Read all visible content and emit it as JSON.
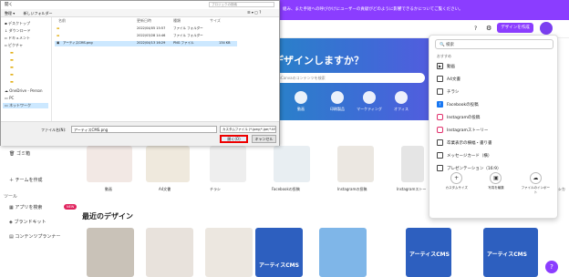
{
  "banner": {
    "text": "組み、また手短への呼びかけにユーザーの貢献がどのように影響できるかについてご覧ください。"
  },
  "topbar": {
    "create_button": "デザインを作成",
    "help_icon": "?",
    "settings_icon": "gear"
  },
  "hero": {
    "title": "デザインしますか？",
    "search_placeholder": "お使いのCanvaのコンテンツを検索"
  },
  "hero_categories": [
    {
      "label": "動画"
    },
    {
      "label": "印刷製品"
    },
    {
      "label": "マーケティング"
    },
    {
      "label": "オフィス"
    }
  ],
  "sidebar": {
    "items": [
      {
        "label": "ゴミ箱"
      },
      {
        "label": "チームを作成"
      },
      {
        "label": "ツール"
      },
      {
        "label": "アプリを検索"
      },
      {
        "label": "ブランドキット"
      },
      {
        "label": "コンテンツプランナー"
      }
    ],
    "new_badge": "NEW"
  },
  "templates": [
    {
      "label": "動画"
    },
    {
      "label": "A4文書"
    },
    {
      "label": "チラシ"
    },
    {
      "label": "Facebookの投稿"
    },
    {
      "label": "Instagramの投稿"
    },
    {
      "label": "Instagramストー"
    },
    {
      "label": "セーシカ"
    }
  ],
  "recent": {
    "title": "最近のデザイン",
    "tile_texts": [
      "アーティスCMS",
      "アーティスCMS",
      "アーティスCMS"
    ]
  },
  "dropdown": {
    "search_value": "検索",
    "section_label": "おすすめ",
    "items": [
      {
        "label": "動画",
        "icon": "video-icon"
      },
      {
        "label": "A4文書",
        "icon": "doc-icon"
      },
      {
        "label": "チラシ",
        "icon": "flyer-icon"
      },
      {
        "label": "Facebookの投稿",
        "icon": "facebook-icon"
      },
      {
        "label": "Instagramの投稿",
        "icon": "instagram-icon"
      },
      {
        "label": "Instagramストーリー",
        "icon": "instagram-icon"
      },
      {
        "label": "卒業表示の横幅・書り書",
        "icon": "doc-icon"
      },
      {
        "label": "メッセージカード（横）",
        "icon": "card-icon"
      },
      {
        "label": "プレゼンテーション（16:9）",
        "icon": "presentation-icon"
      }
    ],
    "bottom": [
      {
        "label": "カスタムサイズ",
        "icon": "+"
      },
      {
        "label": "写真を編集",
        "icon": "▣"
      },
      {
        "label": "ファイルのインポート",
        "icon": "☁"
      }
    ]
  },
  "file_dialog": {
    "title": "開く",
    "search_placeholder": "プロジェクの検索",
    "toolbar": {
      "organize": "整理 ▾",
      "new_folder": "新しいフォルダー"
    },
    "tree": [
      {
        "label": "デスクトップ"
      },
      {
        "label": "ダウンロード"
      },
      {
        "label": "ドキュメント"
      },
      {
        "label": "ピクチャ"
      },
      {
        "label": "OneDrive - Person"
      },
      {
        "label": "PC"
      },
      {
        "label": "ネットワーク"
      }
    ],
    "columns": {
      "name": "名前",
      "date": "更新日時",
      "type": "種類",
      "size": "サイズ"
    },
    "files": [
      {
        "name": "",
        "date": "2022/04/05 15:57",
        "type": "ファイル フォルダー",
        "size": ""
      },
      {
        "name": "",
        "date": "2022/03/28 14:46",
        "type": "ファイル フォルダー",
        "size": ""
      },
      {
        "name": "アーティスCMS.png",
        "date": "2022/04/13 16:29",
        "type": "PNG ファイル",
        "size": "134 KB"
      }
    ],
    "filename_label": "ファイル名(N):",
    "filename_value": "アーティスCMS.png",
    "filetype_value": "カスタムファイル (*.jpeg;*.jpe;*.tif;*.gif",
    "open_button": "開く(O)",
    "cancel_button": "キャンセル"
  }
}
